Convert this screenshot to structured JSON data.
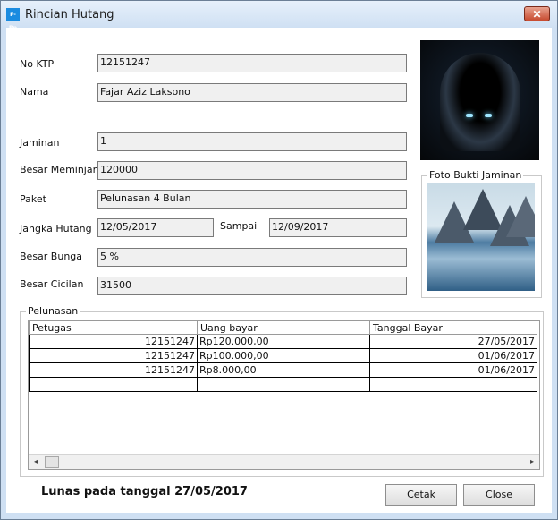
{
  "window": {
    "title": "Rincian Hutang",
    "app_icon": "P-Rp",
    "close_symbol": "✕"
  },
  "form": {
    "no_ktp_label": "No KTP",
    "no_ktp_value": "12151247",
    "nama_label": "Nama",
    "nama_value": "Fajar Aziz Laksono",
    "jaminan_label": "Jaminan",
    "jaminan_value": "1",
    "besar_meminjam_label": "Besar Meminjam",
    "besar_meminjam_value": "120000",
    "paket_label": "Paket",
    "paket_value": "Pelunasan 4 Bulan",
    "jangka_hutang_label": "Jangka Hutang",
    "jangka_hutang_value": "12/05/2017",
    "sampai_label": "Sampai",
    "sampai_value": "12/09/2017",
    "besar_bunga_label": "Besar Bunga",
    "besar_bunga_value": "5 %",
    "besar_cicilan_label": "Besar Cicilan",
    "besar_cicilan_value": "31500"
  },
  "foto_bukti": {
    "label": "Foto Bukti Jaminan"
  },
  "pelunasan": {
    "group_label": "Pelunasan",
    "columns": [
      "Petugas",
      "Uang bayar",
      "Tanggal Bayar"
    ],
    "rows": [
      [
        "12151247",
        "Rp120.000,00",
        "27/05/2017"
      ],
      [
        "12151247",
        "Rp100.000,00",
        "01/06/2017"
      ],
      [
        "12151247",
        "Rp8.000,00",
        "01/06/2017"
      ],
      [
        "",
        "",
        ""
      ]
    ]
  },
  "status_text": "Lunas pada tanggal 27/05/2017",
  "buttons": {
    "cetak": "Cetak",
    "close": "Close"
  },
  "icons": {
    "scroll_left": "◂",
    "scroll_right": "▸"
  }
}
